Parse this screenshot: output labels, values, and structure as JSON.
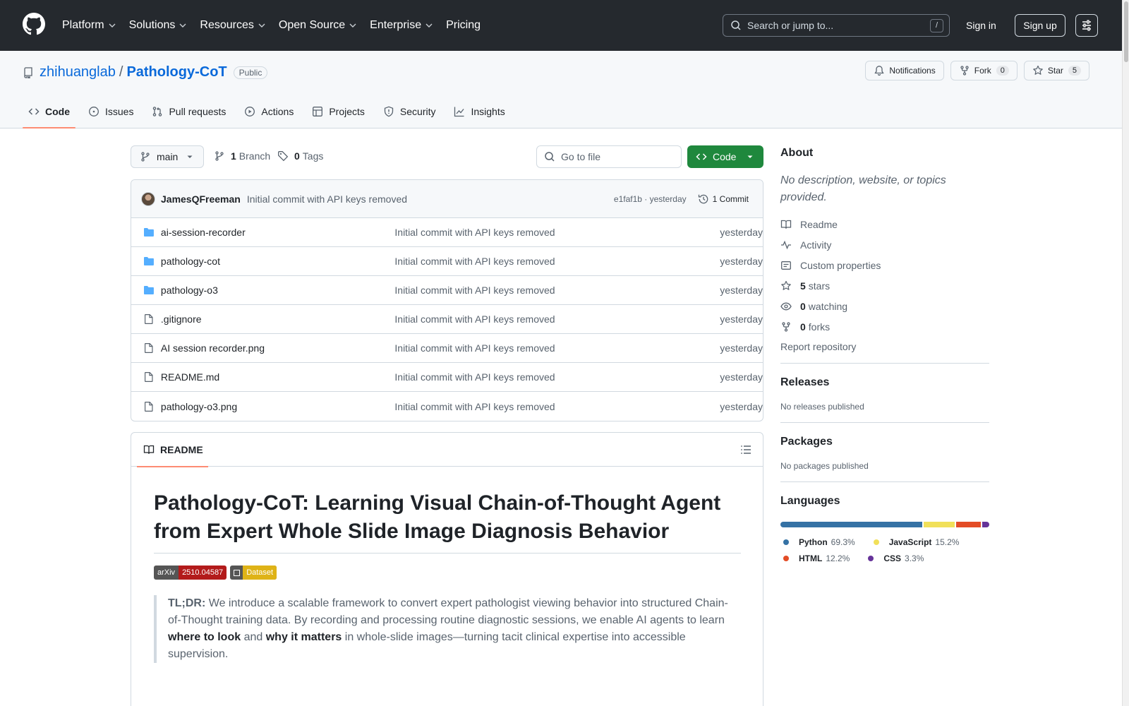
{
  "topnav": {
    "items": [
      {
        "label": "Platform",
        "dropdown": true
      },
      {
        "label": "Solutions",
        "dropdown": true
      },
      {
        "label": "Resources",
        "dropdown": true
      },
      {
        "label": "Open Source",
        "dropdown": true
      },
      {
        "label": "Enterprise",
        "dropdown": true
      },
      {
        "label": "Pricing",
        "dropdown": false
      }
    ],
    "search_placeholder": "Search or jump to...",
    "search_shortcut": "/",
    "signin": "Sign in",
    "signup": "Sign up"
  },
  "repo": {
    "owner": "zhihuanglab",
    "separator": "/",
    "name": "Pathology-CoT",
    "visibility": "Public",
    "notifications_label": "Notifications",
    "fork_label": "Fork",
    "fork_count": "0",
    "star_label": "Star",
    "star_count": "5",
    "tabs": [
      {
        "label": "Code",
        "icon": "code-icon",
        "active": true
      },
      {
        "label": "Issues",
        "icon": "issue-icon",
        "active": false
      },
      {
        "label": "Pull requests",
        "icon": "pull-request-icon",
        "active": false
      },
      {
        "label": "Actions",
        "icon": "play-icon",
        "active": false
      },
      {
        "label": "Projects",
        "icon": "table-icon",
        "active": false
      },
      {
        "label": "Security",
        "icon": "shield-icon",
        "active": false
      },
      {
        "label": "Insights",
        "icon": "graph-icon",
        "active": false
      }
    ]
  },
  "toolbar": {
    "branch": "main",
    "branch_count": "1",
    "branch_label": "Branch",
    "tag_count": "0",
    "tag_label": "Tags",
    "goto_file_placeholder": "Go to file",
    "code_button": "Code"
  },
  "commit": {
    "author": "JamesQFreeman",
    "message": "Initial commit with API keys removed",
    "sha_time": "e1faf1b · yesterday",
    "count_label": "1 Commit"
  },
  "files": [
    {
      "type": "folder",
      "name": "ai-session-recorder",
      "message": "Initial commit with API keys removed",
      "age": "yesterday"
    },
    {
      "type": "folder",
      "name": "pathology-cot",
      "message": "Initial commit with API keys removed",
      "age": "yesterday"
    },
    {
      "type": "folder",
      "name": "pathology-o3",
      "message": "Initial commit with API keys removed",
      "age": "yesterday"
    },
    {
      "type": "file",
      "name": ".gitignore",
      "message": "Initial commit with API keys removed",
      "age": "yesterday"
    },
    {
      "type": "file",
      "name": "AI session recorder.png",
      "message": "Initial commit with API keys removed",
      "age": "yesterday"
    },
    {
      "type": "file",
      "name": "README.md",
      "message": "Initial commit with API keys removed",
      "age": "yesterday"
    },
    {
      "type": "file",
      "name": "pathology-o3.png",
      "message": "Initial commit with API keys removed",
      "age": "yesterday"
    }
  ],
  "readme": {
    "tab_label": "README",
    "title": "Pathology-CoT: Learning Visual Chain-of-Thought Agent from Expert Whole Slide Image Diagnosis Behavior",
    "badges": [
      {
        "left": "arXiv",
        "right": "2510.04587",
        "color": "#b31b1b"
      },
      {
        "left": "",
        "right": "Dataset",
        "color": "#dfb317"
      }
    ],
    "tldr_label": "TL;DR:",
    "tldr_part1": "We introduce a scalable framework to convert expert pathologist viewing behavior into structured Chain-of-Thought training data. By recording and processing routine diagnostic sessions, we enable AI agents to learn",
    "tldr_strong1": "where to look",
    "tldr_and": "and",
    "tldr_strong2": "why it matters",
    "tldr_part2": "in whole-slide images—turning tacit clinical expertise into accessible supervision."
  },
  "sidebar": {
    "about_heading": "About",
    "about_desc": "No description, website, or topics provided.",
    "items": [
      {
        "icon": "book-icon",
        "strong": "",
        "label": "Readme"
      },
      {
        "icon": "pulse-icon",
        "strong": "",
        "label": "Activity"
      },
      {
        "icon": "note-icon",
        "strong": "",
        "label": "Custom properties"
      },
      {
        "icon": "star-icon",
        "strong": "5",
        "label": "stars"
      },
      {
        "icon": "eye-icon",
        "strong": "0",
        "label": "watching"
      },
      {
        "icon": "fork-icon",
        "strong": "0",
        "label": "forks"
      }
    ],
    "report": "Report repository",
    "releases_heading": "Releases",
    "releases_text": "No releases published",
    "packages_heading": "Packages",
    "packages_text": "No packages published",
    "languages_heading": "Languages",
    "languages": [
      {
        "name": "Python",
        "percent": "69.3%",
        "share": 69.3,
        "color": "#3572A5"
      },
      {
        "name": "JavaScript",
        "percent": "15.2%",
        "share": 15.2,
        "color": "#f1e05a"
      },
      {
        "name": "HTML",
        "percent": "12.2%",
        "share": 12.2,
        "color": "#e34c26"
      },
      {
        "name": "CSS",
        "percent": "3.3%",
        "share": 3.3,
        "color": "#663399"
      }
    ]
  },
  "colors": {
    "header_bg": "#25292e",
    "link": "#0969da",
    "primary_button": "#1f883d",
    "active_tab_underline": "#fd8c73"
  }
}
